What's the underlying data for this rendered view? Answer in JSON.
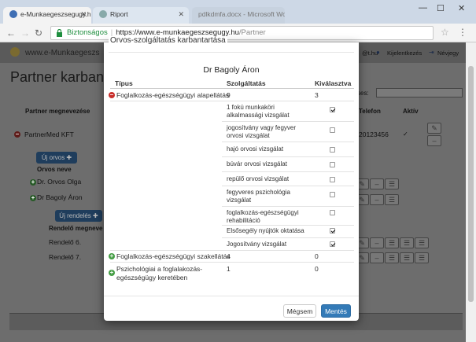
{
  "browser": {
    "tabs": [
      {
        "label": "e-Munkaegeszsegugy.hu"
      },
      {
        "label": "Riport"
      },
      {
        "label": "pdlkdmfa.docx - Microsoft Word"
      }
    ],
    "security_label": "Biztonságos",
    "url_host": "https://www.e-munkaegeszsegugy.hu",
    "url_path": "/Partner"
  },
  "site": {
    "logo_text": "www.e-Munkaegeszs",
    "user_email_suffix": "@t.hu",
    "logout_label": "Kijelentkezés",
    "help_label": "Névjegy"
  },
  "page": {
    "title": "Partner karbanta",
    "search_label": "ses:",
    "partner_header": "Partner megnevezése",
    "telefon_header": "Telefon",
    "aktiv_header": "Aktív",
    "partner_name": "PartnerMed KFT",
    "partner_phone": "20123456",
    "new_doctor_label": "Új orvos",
    "doctor_header": "Orvos neve",
    "doctors": [
      "Dr. Orvos Olga",
      "Dr Bagoly Áron"
    ],
    "new_office_label": "Új rendelés",
    "office_header": "Rendelő megneve",
    "offices": [
      "Rendelő 6.",
      "Rendelő 7."
    ]
  },
  "modal": {
    "title": "Orvos-szolgáltatás karbantartása",
    "doctor_name": "Dr Bagoly Áron",
    "col_type": "Típus",
    "col_service": "Szolgáltatás",
    "col_selected": "Kiválasztva",
    "groups": [
      {
        "name": "Foglalkozás-egészségügyi alapellátás",
        "count": "9",
        "selected": "3",
        "expanded": true
      },
      {
        "name": "Foglalkozás-egészségügyi szakellátás",
        "count": "4",
        "selected": "0",
        "expanded": false
      },
      {
        "name": "Pszichológiai a foglalakozás-egészségügy keretében",
        "count": "1",
        "selected": "0",
        "expanded": false
      }
    ],
    "services": [
      {
        "label": "1 fokú munkaköri alkalmassági vizsgálat",
        "checked": true
      },
      {
        "label": "jogosítvány vagy fegyver orvosi vizsgálat",
        "checked": false
      },
      {
        "label": "hajó orvosi vizsgálat",
        "checked": false
      },
      {
        "label": "búvár orvosi vizsgálat",
        "checked": false
      },
      {
        "label": "repülő orvosi vizsgálat",
        "checked": false
      },
      {
        "label": "fegyveres pszichológia vizsgálat",
        "checked": false
      },
      {
        "label": "foglalkozás-egészségügyi rehabilitáció",
        "checked": false
      },
      {
        "label": "Elsősegély nyújtók oktatása",
        "checked": true
      },
      {
        "label": "Jogosítvány vizsgálat",
        "checked": true
      }
    ],
    "cancel_label": "Mégsem",
    "save_label": "Mentés"
  },
  "colors": {
    "primary_button": "#337ab7",
    "minus_icon": "#c9302c",
    "plus_icon": "#449d44"
  }
}
